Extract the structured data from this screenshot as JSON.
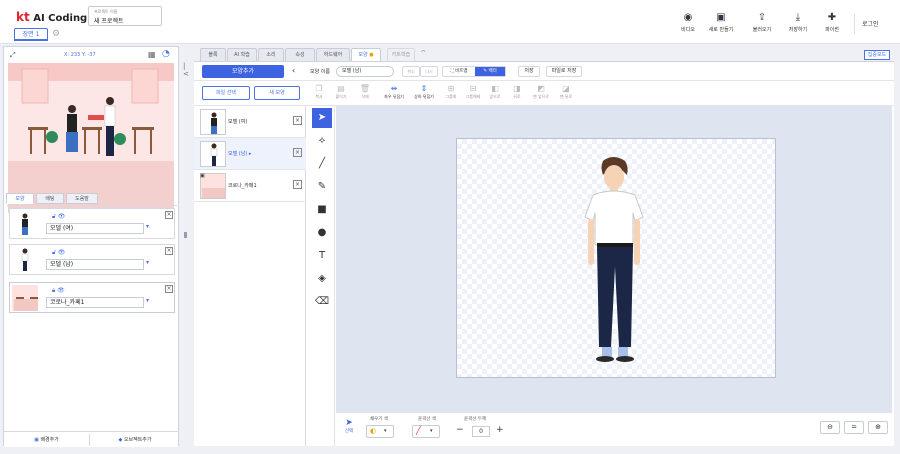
{
  "app": {
    "logo_kt": "kt",
    "logo_text": "AI Coding Block"
  },
  "project": {
    "label": "프로젝트 이름",
    "value": "새 프로젝트"
  },
  "scene": {
    "tab": "장면 1",
    "add_icon": "gear-icon"
  },
  "toolbar": [
    {
      "label": "비디오",
      "icon": "video-icon"
    },
    {
      "label": "새로 만들기",
      "icon": "new-icon"
    },
    {
      "label": "불러오기",
      "icon": "upload-icon"
    },
    {
      "label": "저장하기",
      "icon": "download-icon"
    },
    {
      "label": "파이썬",
      "icon": "python-icon"
    }
  ],
  "login": "로그인",
  "stage": {
    "coord": "X: 233 Y: -37"
  },
  "left_tabs": [
    "모양",
    "배팅",
    "도움말"
  ],
  "objects": [
    {
      "name": "모델 (여)"
    },
    {
      "name": "모델 (남)"
    },
    {
      "name": "코로나_카페1"
    }
  ],
  "left_footer": {
    "bg": "배경추가",
    "shape": "오브젝트추가"
  },
  "top_tabs": [
    "블록",
    "AI 학습",
    "소리",
    "속성",
    "하드웨어",
    "모양",
    "키트학습"
  ],
  "focus_mode": "집중모드",
  "shape_editor": {
    "add_shape": "모양추가",
    "name_label": "모양 이름",
    "name_value": "모델 (남)",
    "undo": "취소",
    "redo": "다시",
    "bitmap": "비트맵",
    "vector": "벡터",
    "save": "저장",
    "save_as": "파일로 저장",
    "file_select": "파일 선택",
    "new_shape": "새 모양"
  },
  "edit_tools": [
    "복사",
    "붙이기",
    "삭제",
    "좌우 뒤집기",
    "상하 뒤집기",
    "그룹화",
    "그룹해제",
    "앞으로",
    "뒤로",
    "맨 앞으로",
    "맨 뒤로"
  ],
  "shapes": [
    {
      "name": "모델 (여)"
    },
    {
      "name": "모델 (남) ▸"
    },
    {
      "name": "코로나_카페1"
    }
  ],
  "bottom": {
    "select_label": "선택",
    "fill_label": "채우기 색",
    "stroke_label": "윤곽선 색",
    "width_label": "윤곽선 두께",
    "width_value": "0"
  },
  "colors": {
    "accent": "#3d63e0",
    "brand_red": "#e1232f"
  }
}
